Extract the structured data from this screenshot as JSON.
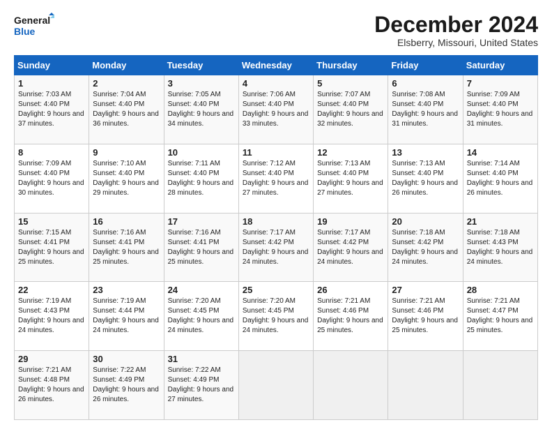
{
  "logo": {
    "line1": "General",
    "line2": "Blue"
  },
  "title": "December 2024",
  "subtitle": "Elsberry, Missouri, United States",
  "days_header": [
    "Sunday",
    "Monday",
    "Tuesday",
    "Wednesday",
    "Thursday",
    "Friday",
    "Saturday"
  ],
  "weeks": [
    [
      {
        "day": "1",
        "sunrise": "7:03 AM",
        "sunset": "4:40 PM",
        "daylight": "9 hours and 37 minutes."
      },
      {
        "day": "2",
        "sunrise": "7:04 AM",
        "sunset": "4:40 PM",
        "daylight": "9 hours and 36 minutes."
      },
      {
        "day": "3",
        "sunrise": "7:05 AM",
        "sunset": "4:40 PM",
        "daylight": "9 hours and 34 minutes."
      },
      {
        "day": "4",
        "sunrise": "7:06 AM",
        "sunset": "4:40 PM",
        "daylight": "9 hours and 33 minutes."
      },
      {
        "day": "5",
        "sunrise": "7:07 AM",
        "sunset": "4:40 PM",
        "daylight": "9 hours and 32 minutes."
      },
      {
        "day": "6",
        "sunrise": "7:08 AM",
        "sunset": "4:40 PM",
        "daylight": "9 hours and 31 minutes."
      },
      {
        "day": "7",
        "sunrise": "7:09 AM",
        "sunset": "4:40 PM",
        "daylight": "9 hours and 31 minutes."
      }
    ],
    [
      {
        "day": "8",
        "sunrise": "7:09 AM",
        "sunset": "4:40 PM",
        "daylight": "9 hours and 30 minutes."
      },
      {
        "day": "9",
        "sunrise": "7:10 AM",
        "sunset": "4:40 PM",
        "daylight": "9 hours and 29 minutes."
      },
      {
        "day": "10",
        "sunrise": "7:11 AM",
        "sunset": "4:40 PM",
        "daylight": "9 hours and 28 minutes."
      },
      {
        "day": "11",
        "sunrise": "7:12 AM",
        "sunset": "4:40 PM",
        "daylight": "9 hours and 27 minutes."
      },
      {
        "day": "12",
        "sunrise": "7:13 AM",
        "sunset": "4:40 PM",
        "daylight": "9 hours and 27 minutes."
      },
      {
        "day": "13",
        "sunrise": "7:13 AM",
        "sunset": "4:40 PM",
        "daylight": "9 hours and 26 minutes."
      },
      {
        "day": "14",
        "sunrise": "7:14 AM",
        "sunset": "4:40 PM",
        "daylight": "9 hours and 26 minutes."
      }
    ],
    [
      {
        "day": "15",
        "sunrise": "7:15 AM",
        "sunset": "4:41 PM",
        "daylight": "9 hours and 25 minutes."
      },
      {
        "day": "16",
        "sunrise": "7:16 AM",
        "sunset": "4:41 PM",
        "daylight": "9 hours and 25 minutes."
      },
      {
        "day": "17",
        "sunrise": "7:16 AM",
        "sunset": "4:41 PM",
        "daylight": "9 hours and 25 minutes."
      },
      {
        "day": "18",
        "sunrise": "7:17 AM",
        "sunset": "4:42 PM",
        "daylight": "9 hours and 24 minutes."
      },
      {
        "day": "19",
        "sunrise": "7:17 AM",
        "sunset": "4:42 PM",
        "daylight": "9 hours and 24 minutes."
      },
      {
        "day": "20",
        "sunrise": "7:18 AM",
        "sunset": "4:42 PM",
        "daylight": "9 hours and 24 minutes."
      },
      {
        "day": "21",
        "sunrise": "7:18 AM",
        "sunset": "4:43 PM",
        "daylight": "9 hours and 24 minutes."
      }
    ],
    [
      {
        "day": "22",
        "sunrise": "7:19 AM",
        "sunset": "4:43 PM",
        "daylight": "9 hours and 24 minutes."
      },
      {
        "day": "23",
        "sunrise": "7:19 AM",
        "sunset": "4:44 PM",
        "daylight": "9 hours and 24 minutes."
      },
      {
        "day": "24",
        "sunrise": "7:20 AM",
        "sunset": "4:45 PM",
        "daylight": "9 hours and 24 minutes."
      },
      {
        "day": "25",
        "sunrise": "7:20 AM",
        "sunset": "4:45 PM",
        "daylight": "9 hours and 24 minutes."
      },
      {
        "day": "26",
        "sunrise": "7:21 AM",
        "sunset": "4:46 PM",
        "daylight": "9 hours and 25 minutes."
      },
      {
        "day": "27",
        "sunrise": "7:21 AM",
        "sunset": "4:46 PM",
        "daylight": "9 hours and 25 minutes."
      },
      {
        "day": "28",
        "sunrise": "7:21 AM",
        "sunset": "4:47 PM",
        "daylight": "9 hours and 25 minutes."
      }
    ],
    [
      {
        "day": "29",
        "sunrise": "7:21 AM",
        "sunset": "4:48 PM",
        "daylight": "9 hours and 26 minutes."
      },
      {
        "day": "30",
        "sunrise": "7:22 AM",
        "sunset": "4:49 PM",
        "daylight": "9 hours and 26 minutes."
      },
      {
        "day": "31",
        "sunrise": "7:22 AM",
        "sunset": "4:49 PM",
        "daylight": "9 hours and 27 minutes."
      },
      null,
      null,
      null,
      null
    ]
  ],
  "labels": {
    "sunrise": "Sunrise:",
    "sunset": "Sunset:",
    "daylight": "Daylight:"
  }
}
